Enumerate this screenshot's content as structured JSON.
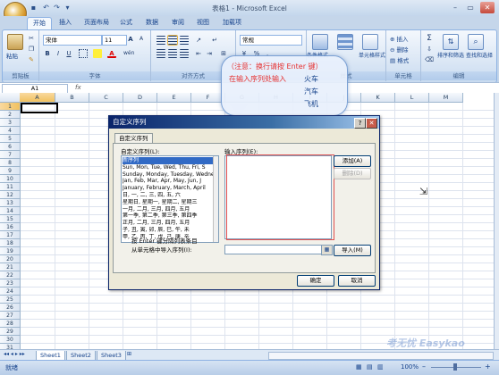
{
  "window": {
    "title": "表格1 - Microsoft Excel",
    "quick_access": [
      "↶",
      "↷",
      "▾"
    ],
    "controls": {
      "minimize": "–",
      "restore": "▭",
      "close": "✕"
    }
  },
  "ribbon_tabs": [
    "开始",
    "插入",
    "页面布局",
    "公式",
    "数据",
    "审阅",
    "视图",
    "加载项"
  ],
  "ribbon": {
    "clipboard": {
      "label": "剪贴板",
      "paste": "粘贴"
    },
    "font": {
      "label": "字体",
      "font_name": "宋体",
      "font_size": "11",
      "grow": "A",
      "shrink": "A",
      "bold": "B",
      "italic": "I",
      "underline": "U",
      "phonetic": "wén"
    },
    "alignment": {
      "label": "对齐方式"
    },
    "number": {
      "label": "数字",
      "format": "常规",
      "pct": "%",
      "comma": ","
    },
    "styles": {
      "label": "样式",
      "conditional": "条件格式",
      "table": "套用表格格式",
      "cell": "单元格样式"
    },
    "cells": {
      "label": "单元格",
      "insert": "插入",
      "delete": "删除",
      "format": "格式"
    },
    "editing": {
      "label": "编辑",
      "sort": "排序和筛选",
      "find": "查找和选择",
      "sigma": "Σ"
    }
  },
  "formula_bar": {
    "name_box": "A1",
    "fx": "fx",
    "value": ""
  },
  "columns": [
    "A",
    "B",
    "C",
    "D",
    "E",
    "F",
    "G",
    "H",
    "I",
    "J",
    "K",
    "L",
    "M"
  ],
  "rows": [
    "1",
    "2",
    "3",
    "4",
    "5",
    "6",
    "7",
    "8",
    "9",
    "10",
    "11",
    "12",
    "13",
    "14",
    "15",
    "16",
    "17",
    "18",
    "19",
    "20",
    "21",
    "22",
    "23",
    "24",
    "25",
    "26",
    "27",
    "28",
    "29",
    "30",
    "31"
  ],
  "sheet_tabs": [
    "Sheet1",
    "Sheet2",
    "Sheet3"
  ],
  "status": {
    "left": "就绪",
    "zoom": "100%",
    "zoom_minus": "–",
    "zoom_plus": "+"
  },
  "dialog": {
    "title": "自定义序列",
    "help": "?",
    "close": "✕",
    "tab": "自定义序列",
    "list_label": "自定义序列(L):",
    "entries_label": "输入序列(E):",
    "list_items": [
      "新序列",
      "Sun, Mon, Tue, Wed, Thu, Fri, S",
      "Sunday, Monday, Tuesday, Wednes",
      "Jan, Feb, Mar, Apr, May, Jun, J",
      "January, February, March, April",
      "日, 一, 二, 三, 四, 五, 六",
      "星期日, 星期一, 星期二, 星期三",
      "一月, 二月, 三月, 四月, 五月",
      "第一季, 第二季, 第三季, 第四季",
      "正月, 二月, 三月, 四月, 五月",
      "子, 丑, 寅, 卯, 辰, 巳, 午, 未",
      "甲, 乙, 丙, 丁, 戊, 己, 庚, 辛"
    ],
    "add_button": "添加(A)",
    "delete_button": "删除(D)",
    "import_label_1": "按 Enter 键分隔列表条目",
    "import_label_2": "从单元格中导入序列(I):",
    "import_button": "导入(M)",
    "ok_button": "确定",
    "cancel_button": "取消"
  },
  "callout": {
    "line1": "（注意：换行请按 Enter 键）",
    "line2": "在输入序列处输入",
    "item1": "火车",
    "item2": "汽车",
    "item3": "飞机"
  },
  "watermark": "考无忧 Easykao",
  "colors": {
    "accent": "#15428b",
    "ribbon_bg": "#dbe7f5",
    "dialog_title": "#0a246a",
    "callout_red": "#e53030"
  }
}
